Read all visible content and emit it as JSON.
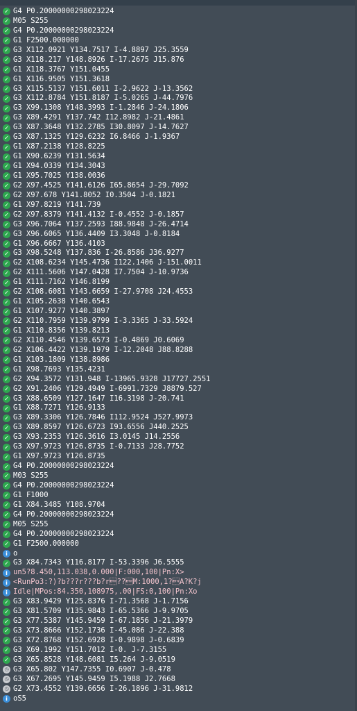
{
  "colors": {
    "background": "#424c56",
    "ok": "#2ea84f",
    "info": "#3b8fd9",
    "pending": "#c9ccd0",
    "pink_text": "#f5c6cf"
  },
  "log": [
    {
      "status": "ok",
      "text": "G4 P0.20000000298023224"
    },
    {
      "status": "ok",
      "text": "M05 S255"
    },
    {
      "status": "ok",
      "text": "G4 P0.20000000298023224"
    },
    {
      "status": "ok",
      "text": "G1 F2500.000000"
    },
    {
      "status": "ok",
      "text": "G3 X112.0921 Y134.7517 I-4.8897 J25.3559"
    },
    {
      "status": "ok",
      "text": "G3 X118.217 Y148.8926 I-17.2675 J15.876"
    },
    {
      "status": "ok",
      "text": "G1 X118.3767 Y151.0455"
    },
    {
      "status": "ok",
      "text": "G1 X116.9505 Y151.3618"
    },
    {
      "status": "ok",
      "text": "G3 X115.5137 Y151.6011 I-2.9622 J-13.3562"
    },
    {
      "status": "ok",
      "text": "G3 X112.8784 Y151.8187 I-5.0265 J-44.7976"
    },
    {
      "status": "ok",
      "text": "G3 X99.1308 Y148.3993 I-1.2846 J-24.1806"
    },
    {
      "status": "ok",
      "text": "G3 X89.4291 Y137.742 I12.8982 J-21.4861"
    },
    {
      "status": "ok",
      "text": "G3 X87.3648 Y132.2785 I30.8097 J-14.7627"
    },
    {
      "status": "ok",
      "text": "G3 X87.1325 Y129.6232 I6.8466 J-1.9367"
    },
    {
      "status": "ok",
      "text": "G1 X87.2138 Y128.8225"
    },
    {
      "status": "ok",
      "text": "G1 X90.6239 Y131.5634"
    },
    {
      "status": "ok",
      "text": "G1 X94.0339 Y134.3043"
    },
    {
      "status": "ok",
      "text": "G1 X95.7025 Y138.0036"
    },
    {
      "status": "ok",
      "text": "G2 X97.4525 Y141.6126 I65.8654 J-29.7092"
    },
    {
      "status": "ok",
      "text": "G2 X97.678 Y141.8052 I0.3504 J-0.1821"
    },
    {
      "status": "ok",
      "text": "G1 X97.8219 Y141.739"
    },
    {
      "status": "ok",
      "text": "G2 X97.8379 Y141.4132 I-0.4552 J-0.1857"
    },
    {
      "status": "ok",
      "text": "G3 X96.7064 Y137.2593 I88.9848 J-26.4714"
    },
    {
      "status": "ok",
      "text": "G3 X96.6065 Y136.4409 I3.3048 J-0.8184"
    },
    {
      "status": "ok",
      "text": "G1 X96.6667 Y136.4103"
    },
    {
      "status": "ok",
      "text": "G3 X98.5248 Y137.836 I-26.8586 J36.9277"
    },
    {
      "status": "ok",
      "text": "G2 X108.6234 Y145.4736 I122.1406 J-151.0011"
    },
    {
      "status": "ok",
      "text": "G2 X111.5606 Y147.0428 I7.7504 J-10.9736"
    },
    {
      "status": "ok",
      "text": "G1 X111.7162 Y146.8199"
    },
    {
      "status": "ok",
      "text": "G2 X108.6081 Y143.6659 I-27.9708 J24.4553"
    },
    {
      "status": "ok",
      "text": "G1 X105.2638 Y140.6543"
    },
    {
      "status": "ok",
      "text": "G1 X107.9277 Y140.3897"
    },
    {
      "status": "ok",
      "text": "G2 X110.7959 Y139.9799 I-3.3365 J-33.5924"
    },
    {
      "status": "ok",
      "text": "G1 X110.8356 Y139.8213"
    },
    {
      "status": "ok",
      "text": "G2 X110.4546 Y139.6573 I-0.4869 J0.6069"
    },
    {
      "status": "ok",
      "text": "G2 X106.4422 Y139.1979 I-12.2048 J88.8288"
    },
    {
      "status": "ok",
      "text": "G1 X103.1809 Y138.8986"
    },
    {
      "status": "ok",
      "text": "G1 X98.7693 Y135.4231"
    },
    {
      "status": "ok",
      "text": "G2 X94.3572 Y131.948 I-13965.9328 J17727.2551"
    },
    {
      "status": "ok",
      "text": "G2 X91.2406 Y129.4949 I-6991.7329 J8879.527"
    },
    {
      "status": "ok",
      "text": "G3 X88.6509 Y127.1647 I16.3198 J-20.741"
    },
    {
      "status": "ok",
      "text": "G1 X88.7271 Y126.9133"
    },
    {
      "status": "ok",
      "text": "G3 X89.3306 Y126.7846 I112.9524 J527.9973"
    },
    {
      "status": "ok",
      "text": "G3 X89.8597 Y126.6723 I93.6556 J440.2525"
    },
    {
      "status": "ok",
      "text": "G3 X93.2353 Y126.3616 I3.0145 J14.2556"
    },
    {
      "status": "ok",
      "text": "G3 X97.9723 Y126.8735 I-0.7133 J28.7752"
    },
    {
      "status": "ok",
      "text": "G1 X97.9723 Y126.8735"
    },
    {
      "status": "ok",
      "text": "G4 P0.20000000298023224"
    },
    {
      "status": "ok",
      "text": "M03 S255"
    },
    {
      "status": "ok",
      "text": "G4 P0.20000000298023224"
    },
    {
      "status": "ok",
      "text": "G1 F1000"
    },
    {
      "status": "ok",
      "text": "G1 X84.3485 Y108.9704"
    },
    {
      "status": "ok",
      "text": "G4 P0.20000000298023224"
    },
    {
      "status": "ok",
      "text": "M05 S255"
    },
    {
      "status": "ok",
      "text": "G4 P0.20000000298023224"
    },
    {
      "status": "ok",
      "text": "G1 F2500.000000"
    },
    {
      "status": "info",
      "text": "o"
    },
    {
      "status": "ok",
      "text": "G3 X84.7343 Y116.8177 I-53.3396 J6.5555"
    },
    {
      "status": "info",
      "text": "un5?8.450,113.038,0.000|F:000,100|Pn:X>",
      "pink": true
    },
    {
      "status": "info",
      "text": "<RunPo3:?)?b???r???b?r\u0003??\u0003M:1000,1?\u0003A?K?j",
      "pink": true
    },
    {
      "status": "info",
      "text": "Idle|MPos:84.350,108975,.00|FS:0,100|Pn:Xo",
      "pink": true
    },
    {
      "status": "ok",
      "text": "G3 X83.9429 Y125.8376 I-71.3568 J-1.7156"
    },
    {
      "status": "ok",
      "text": "G3 X81.5709 Y135.9843 I-65.5366 J-9.9705"
    },
    {
      "status": "ok",
      "text": "G3 X77.5387 Y145.9459 I-67.1856 J-21.3979"
    },
    {
      "status": "ok",
      "text": "G3 X73.8666 Y152.1736 I-45.086 J-22.388"
    },
    {
      "status": "ok",
      "text": "G3 X72.8768 Y152.6928 I-0.9898 J-0.6839"
    },
    {
      "status": "ok",
      "text": "G3 X69.1992 Y151.7012 I-0. J-7.3155"
    },
    {
      "status": "ok",
      "text": "G3 X65.8528 Y148.6081 I5.264 J-9.0519"
    },
    {
      "status": "pending",
      "text": "G3 X65.802 Y147.7355 I0.6907 J-0.478"
    },
    {
      "status": "pending",
      "text": "G3 X67.2695 Y145.9459 I5.1988 J2.7668"
    },
    {
      "status": "pending",
      "text": "G2 X73.4552 Y139.6656 I-26.1896 J-31.9812"
    },
    {
      "status": "info",
      "text": "oS5"
    }
  ]
}
